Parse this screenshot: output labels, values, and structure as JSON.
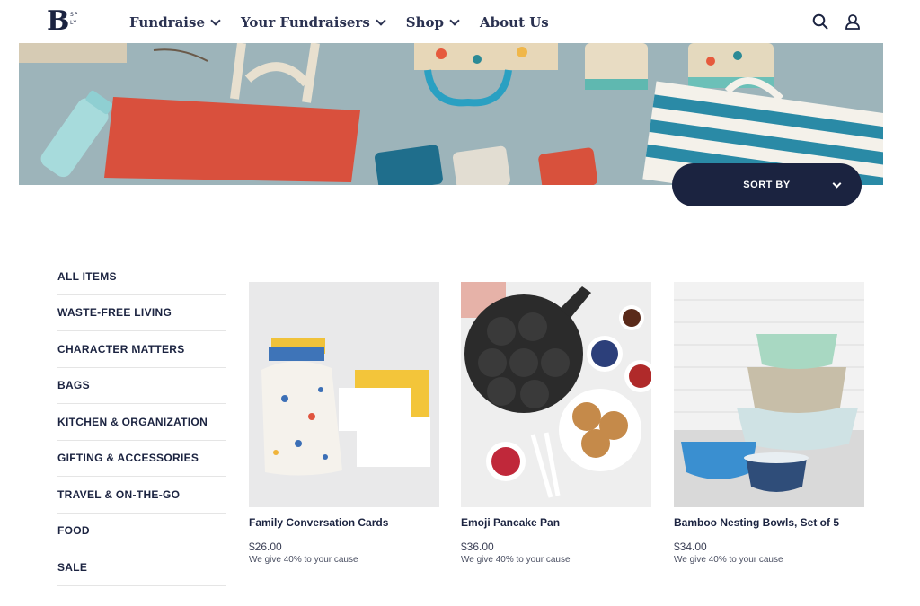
{
  "header": {
    "logo_letter": "B",
    "logo_small_line1": "SP",
    "logo_small_line2": "LY",
    "nav": [
      {
        "label": "Fundraise"
      },
      {
        "label": "Your Fundraisers"
      },
      {
        "label": "Shop"
      },
      {
        "label": "About Us"
      }
    ],
    "icons": [
      "search-icon",
      "user-icon"
    ]
  },
  "sort": {
    "label": "SORT BY"
  },
  "sidebar": {
    "items": [
      {
        "label": "ALL ITEMS"
      },
      {
        "label": "WASTE-FREE LIVING"
      },
      {
        "label": "CHARACTER MATTERS"
      },
      {
        "label": "BAGS"
      },
      {
        "label": "KITCHEN & ORGANIZATION"
      },
      {
        "label": "GIFTING & ACCESSORIES"
      },
      {
        "label": "TRAVEL & ON-THE-GO"
      },
      {
        "label": "FOOD"
      },
      {
        "label": "SALE"
      }
    ]
  },
  "products": [
    {
      "name": "Family Conversation Cards",
      "price": "$26.00",
      "cause": "We give 40% to your cause"
    },
    {
      "name": "Emoji Pancake Pan",
      "price": "$36.00",
      "cause": "We give 40% to your cause"
    },
    {
      "name": "Bamboo Nesting Bowls, Set of 5",
      "price": "$34.00",
      "cause": "We give 40% to your cause"
    }
  ],
  "colors": {
    "navy": "#1b2340",
    "hero_bg": "#9cb3b9",
    "divider": "#e5e5e5"
  }
}
